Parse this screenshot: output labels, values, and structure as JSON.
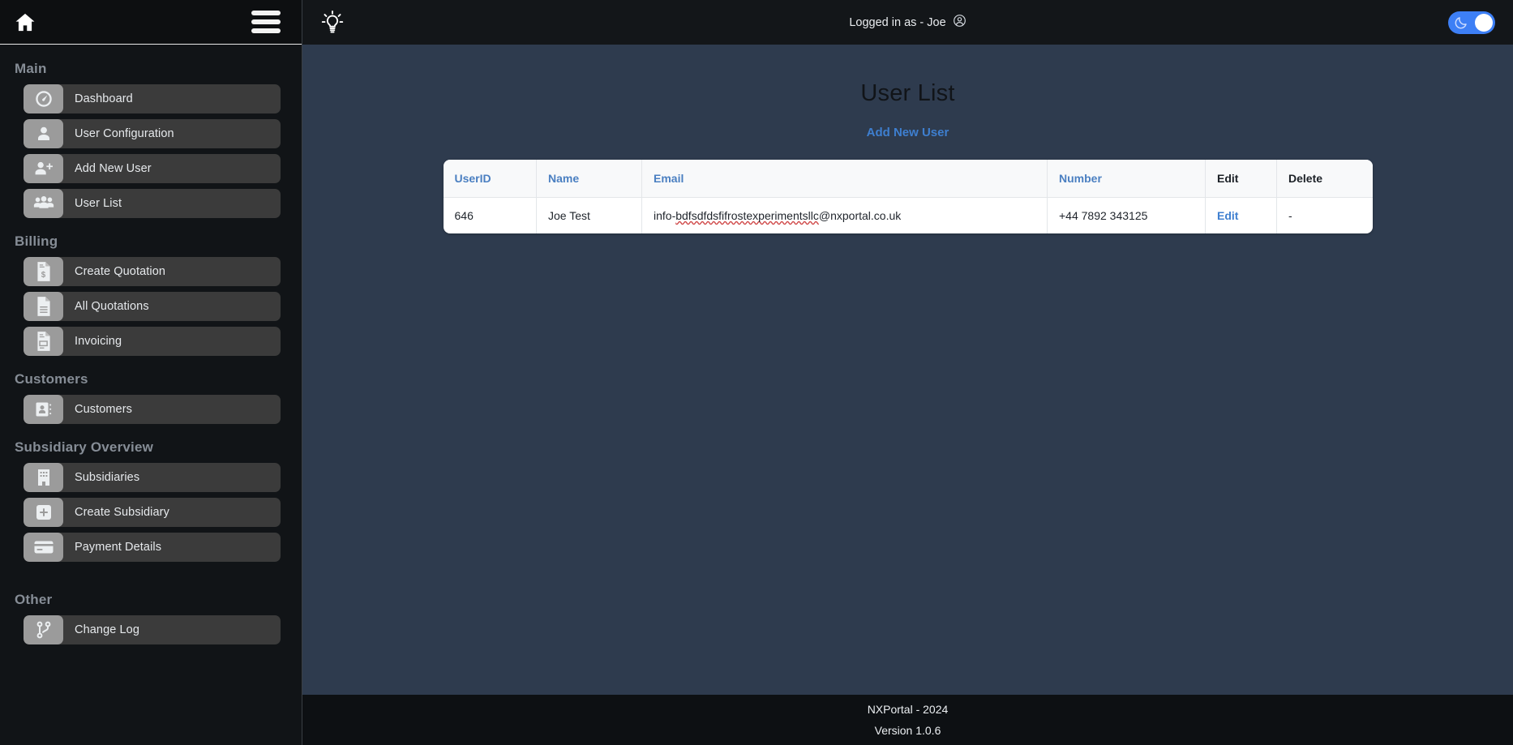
{
  "sidebar": {
    "home_icon": "home-icon",
    "menu_icon": "hamburger-menu-icon",
    "sections": [
      {
        "title": "Main",
        "items": [
          {
            "label": "Dashboard",
            "icon": "gauge-icon"
          },
          {
            "label": "User Configuration",
            "icon": "user-icon"
          },
          {
            "label": "Add New User",
            "icon": "user-plus-icon"
          },
          {
            "label": "User List",
            "icon": "users-group-icon"
          }
        ]
      },
      {
        "title": "Billing",
        "items": [
          {
            "label": "Create Quotation",
            "icon": "document-dollar-icon"
          },
          {
            "label": "All Quotations",
            "icon": "document-lines-icon"
          },
          {
            "label": "Invoicing",
            "icon": "invoice-icon"
          }
        ]
      },
      {
        "title": "Customers",
        "items": [
          {
            "label": "Customers",
            "icon": "contact-card-icon"
          }
        ]
      },
      {
        "title": "Subsidiary Overview",
        "items": [
          {
            "label": "Subsidiaries",
            "icon": "building-icon"
          },
          {
            "label": "Create Subsidiary",
            "icon": "plus-square-icon"
          },
          {
            "label": "Payment Details",
            "icon": "credit-card-icon"
          }
        ]
      },
      {
        "title": "Other",
        "items": [
          {
            "label": "Change Log",
            "icon": "git-branch-icon"
          }
        ]
      }
    ]
  },
  "topbar": {
    "bulb_icon": "lightbulb-icon",
    "logged_in_text": "Logged in as - Joe",
    "avatar_icon": "user-circle-icon",
    "theme_toggle": {
      "icon": "moon-icon",
      "state": "on",
      "color": "#3d7ff5"
    }
  },
  "main": {
    "page_title": "User List",
    "add_new_user_label": "Add New User",
    "link_color": "#3e7fd0",
    "table": {
      "columns": [
        {
          "label": "UserID",
          "style": "link"
        },
        {
          "label": "Name",
          "style": "link"
        },
        {
          "label": "Email",
          "style": "link"
        },
        {
          "label": "Number",
          "style": "link"
        },
        {
          "label": "Edit",
          "style": "dark"
        },
        {
          "label": "Delete",
          "style": "dark"
        }
      ],
      "rows": [
        {
          "userid": "646",
          "name": "Joe Test",
          "email_prefix": "info-",
          "email_misspelled": "bdfsdfdsfifrostexperimentsllc",
          "email_suffix": "@nxportal.co.uk",
          "number": "+44 7892 343125",
          "edit": "Edit",
          "delete": "-"
        }
      ]
    }
  },
  "footer": {
    "copyright": "NXPortal - 2024",
    "version": "Version 1.0.6"
  }
}
